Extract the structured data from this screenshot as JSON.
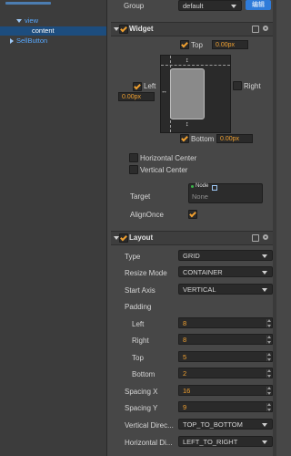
{
  "hierarchy": {
    "items": [
      {
        "label": "view",
        "expanded": true
      },
      {
        "label": "content",
        "selected": true
      },
      {
        "label": "SellButton",
        "expanded": false
      }
    ]
  },
  "group": {
    "label": "Group",
    "value": "default",
    "edit_label": "编辑"
  },
  "widget": {
    "title": "Widget",
    "top_label": "Top",
    "top_value": "0.00px",
    "left_label": "Left",
    "left_value": "0.00px",
    "right_label": "Right",
    "bottom_label": "Bottom",
    "bottom_value": "0.00px",
    "hcenter_label": "Horizontal Center",
    "vcenter_label": "Vertical Center",
    "target_label": "Target",
    "target_tag": "Node",
    "target_value": "None",
    "alignonce_label": "AlignOnce"
  },
  "layout": {
    "title": "Layout",
    "type_label": "Type",
    "type_value": "GRID",
    "resize_label": "Resize Mode",
    "resize_value": "CONTAINER",
    "startaxis_label": "Start Axis",
    "startaxis_value": "VERTICAL",
    "padding_label": "Padding",
    "left_label": "Left",
    "left_value": "8",
    "right_label": "Right",
    "right_value": "8",
    "top_label": "Top",
    "top_value": "5",
    "bottom_label": "Bottom",
    "bottom_value": "2",
    "spacingx_label": "Spacing X",
    "spacingx_value": "16",
    "spacingy_label": "Spacing Y",
    "spacingy_value": "9",
    "vdir_label": "Vertical Direc...",
    "vdir_value": "TOP_TO_BOTTOM",
    "hdir_label": "Horizontal Di...",
    "hdir_value": "LEFT_TO_RIGHT"
  },
  "colors": {
    "accent": "#f0a030",
    "selection": "#1d4d7e",
    "link": "#57a8ff",
    "button": "#2f7bd9"
  }
}
